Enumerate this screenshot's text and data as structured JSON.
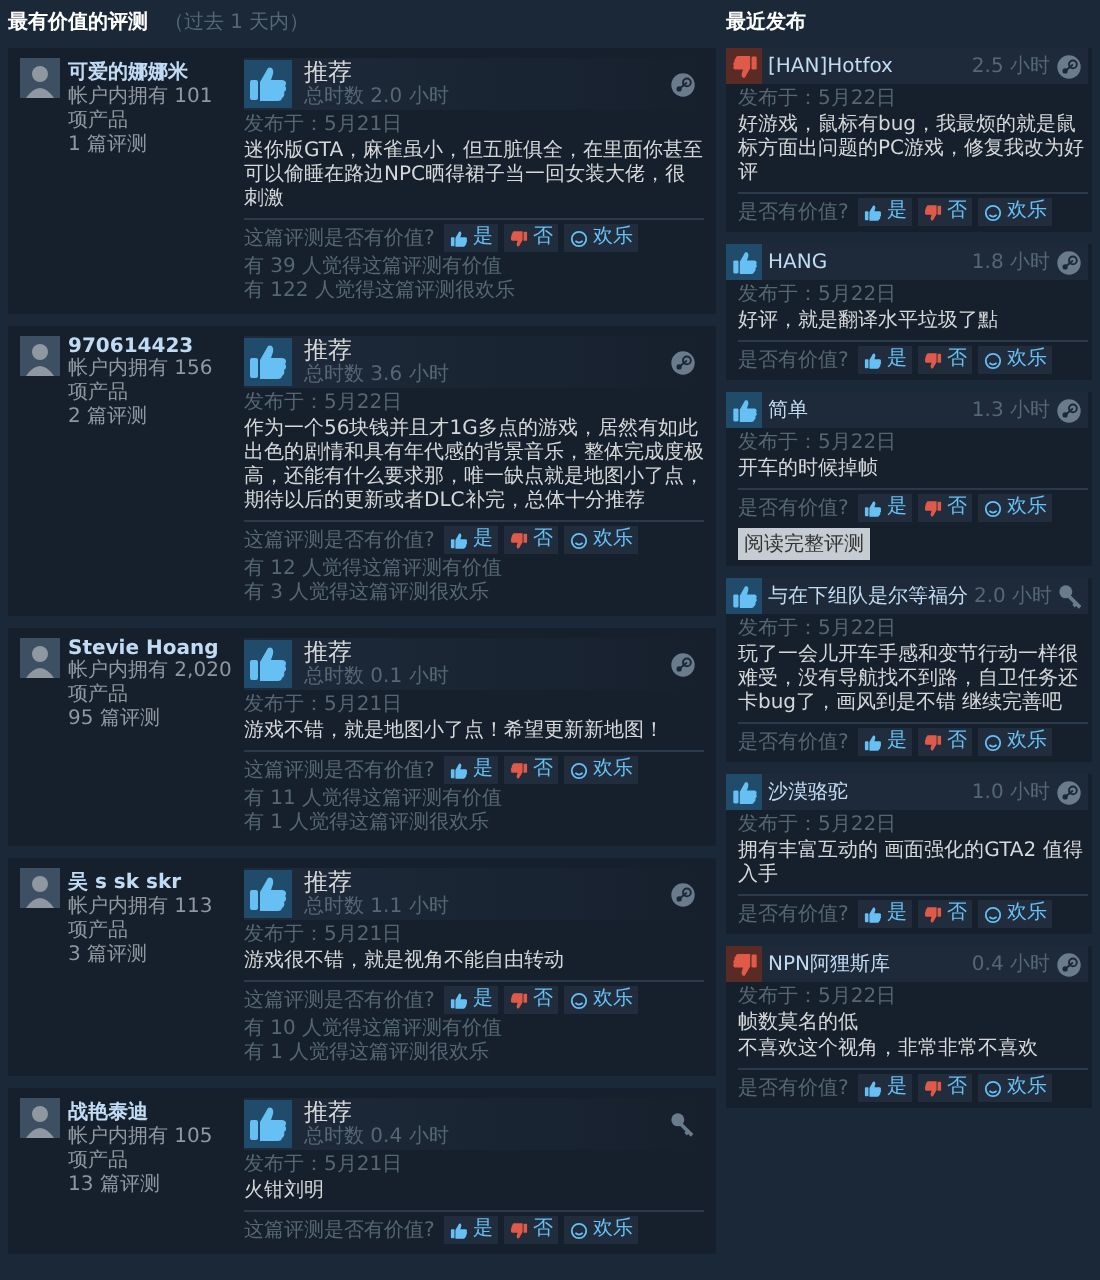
{
  "most_helpful": {
    "title": "最有价值的评测",
    "period": "（过去 1 天内）",
    "reviews": [
      {
        "author": "可爱的娜娜米",
        "products": "帐户内拥有 101 项产品",
        "review_count": "1 篇评测",
        "verdict": "推荐",
        "recommended": true,
        "hours": "总时数 2.0 小时",
        "steam_purchase": true,
        "posted": "发布于：5月21日",
        "text": "迷你版GTA，麻雀虽小，但五脏俱全，在里面你甚至可以偷睡在路边NPC晒得裙子当一回女装大佬，很刺激",
        "helpful_prompt": "这篇评测是否有价值?",
        "buttons": [
          {
            "label": "是",
            "kind": "yes"
          },
          {
            "label": "否",
            "kind": "no"
          },
          {
            "label": "欢乐",
            "kind": "funny"
          }
        ],
        "helpful_count": "有 39 人觉得这篇评测有价值",
        "funny_count": "有 122 人觉得这篇评测很欢乐"
      },
      {
        "author": "970614423",
        "products": "帐户内拥有 156 项产品",
        "review_count": "2 篇评测",
        "verdict": "推荐",
        "recommended": true,
        "hours": "总时数 3.6 小时",
        "steam_purchase": true,
        "posted": "发布于：5月22日",
        "text": "作为一个56块钱并且才1G多点的游戏，居然有如此出色的剧情和具有年代感的背景音乐，整体完成度极高，还能有什么要求那，唯一缺点就是地图小了点，期待以后的更新或者DLC补完，总体十分推荐",
        "helpful_prompt": "这篇评测是否有价值?",
        "buttons": [
          {
            "label": "是",
            "kind": "yes"
          },
          {
            "label": "否",
            "kind": "no"
          },
          {
            "label": "欢乐",
            "kind": "funny"
          }
        ],
        "helpful_count": "有 12 人觉得这篇评测有价值",
        "funny_count": "有 3 人觉得这篇评测很欢乐"
      },
      {
        "author": "Stevie Hoang",
        "products": "帐户内拥有 2,020 项产品",
        "review_count": "95 篇评测",
        "verdict": "推荐",
        "recommended": true,
        "hours": "总时数 0.1 小时",
        "steam_purchase": true,
        "posted": "发布于：5月21日",
        "text": "游戏不错，就是地图小了点！希望更新新地图！",
        "helpful_prompt": "这篇评测是否有价值?",
        "buttons": [
          {
            "label": "是",
            "kind": "yes"
          },
          {
            "label": "否",
            "kind": "no"
          },
          {
            "label": "欢乐",
            "kind": "funny"
          }
        ],
        "helpful_count": "有 11 人觉得这篇评测有价值",
        "funny_count": "有 1 人觉得这篇评测很欢乐"
      },
      {
        "author": "吴 s sk skr",
        "products": "帐户内拥有 113 项产品",
        "review_count": "3 篇评测",
        "verdict": "推荐",
        "recommended": true,
        "hours": "总时数 1.1 小时",
        "steam_purchase": true,
        "posted": "发布于：5月21日",
        "text": "游戏很不错，就是视角不能自由转动",
        "helpful_prompt": "这篇评测是否有价值?",
        "buttons": [
          {
            "label": "是",
            "kind": "yes"
          },
          {
            "label": "否",
            "kind": "no"
          },
          {
            "label": "欢乐",
            "kind": "funny"
          }
        ],
        "helpful_count": "有 10 人觉得这篇评测有价值",
        "funny_count": "有 1 人觉得这篇评测很欢乐"
      },
      {
        "author": "战艳泰迪",
        "products": "帐户内拥有 105 项产品",
        "review_count": "13 篇评测",
        "verdict": "推荐",
        "recommended": true,
        "hours": "总时数 0.4 小时",
        "steam_purchase": false,
        "posted": "发布于：5月21日",
        "text": "火钳刘明",
        "helpful_prompt": "这篇评测是否有价值?",
        "buttons": [
          {
            "label": "是",
            "kind": "yes"
          },
          {
            "label": "否",
            "kind": "no"
          },
          {
            "label": "欢乐",
            "kind": "funny"
          }
        ]
      }
    ]
  },
  "recent": {
    "title": "最近发布",
    "reviews": [
      {
        "author": "[HAN]Hotfox",
        "recommended": false,
        "hours": "2.5 小时",
        "steam_purchase": true,
        "posted": "发布于：5月22日",
        "text": "好游戏，鼠标有bug，我最烦的就是鼠标方面出问题的PC游戏，修复我改为好评",
        "helpful_prompt": "是否有价值?",
        "buttons": [
          {
            "label": "是",
            "kind": "yes"
          },
          {
            "label": "否",
            "kind": "no"
          },
          {
            "label": "欢乐",
            "kind": "funny"
          }
        ]
      },
      {
        "author": "HANG",
        "recommended": true,
        "hours": "1.8 小时",
        "steam_purchase": true,
        "posted": "发布于：5月22日",
        "text": "好评，就是翻译水平垃圾了點",
        "helpful_prompt": "是否有价值?",
        "buttons": [
          {
            "label": "是",
            "kind": "yes"
          },
          {
            "label": "否",
            "kind": "no"
          },
          {
            "label": "欢乐",
            "kind": "funny"
          }
        ]
      },
      {
        "author": "简单",
        "recommended": true,
        "hours": "1.3 小时",
        "steam_purchase": true,
        "posted": "发布于：5月22日",
        "text": "开车的时候掉帧",
        "helpful_prompt": "是否有价值?",
        "buttons": [
          {
            "label": "是",
            "kind": "yes"
          },
          {
            "label": "否",
            "kind": "no"
          },
          {
            "label": "欢乐",
            "kind": "funny"
          }
        ],
        "read_more": "阅读完整评测"
      },
      {
        "author": "与在下组队是尔等福分",
        "recommended": true,
        "hours": "2.0 小时",
        "steam_purchase": false,
        "posted": "发布于：5月22日",
        "text": "玩了一会儿开车手感和变节行动一样很难受，没有导航找不到路，自卫任务还卡bug了，画风到是不错 继续完善吧",
        "helpful_prompt": "是否有价值?",
        "buttons": [
          {
            "label": "是",
            "kind": "yes"
          },
          {
            "label": "否",
            "kind": "no"
          },
          {
            "label": "欢乐",
            "kind": "funny"
          }
        ]
      },
      {
        "author": "沙漠骆驼",
        "recommended": true,
        "hours": "1.0 小时",
        "steam_purchase": true,
        "posted": "发布于：5月22日",
        "text": "拥有丰富互动的 画面强化的GTA2 值得入手",
        "helpful_prompt": "是否有价值?",
        "buttons": [
          {
            "label": "是",
            "kind": "yes"
          },
          {
            "label": "否",
            "kind": "no"
          },
          {
            "label": "欢乐",
            "kind": "funny"
          }
        ]
      },
      {
        "author": "NPN阿狸斯库",
        "recommended": false,
        "hours": "0.4 小时",
        "steam_purchase": true,
        "posted": "发布于：5月22日",
        "text": "帧数莫名的低",
        "text_2": "不喜欢这个视角，非常非常不喜欢",
        "helpful_prompt": "是否有价值?",
        "buttons": [
          {
            "label": "是",
            "kind": "yes"
          },
          {
            "label": "否",
            "kind": "no"
          },
          {
            "label": "欢乐",
            "kind": "funny"
          }
        ]
      }
    ]
  }
}
